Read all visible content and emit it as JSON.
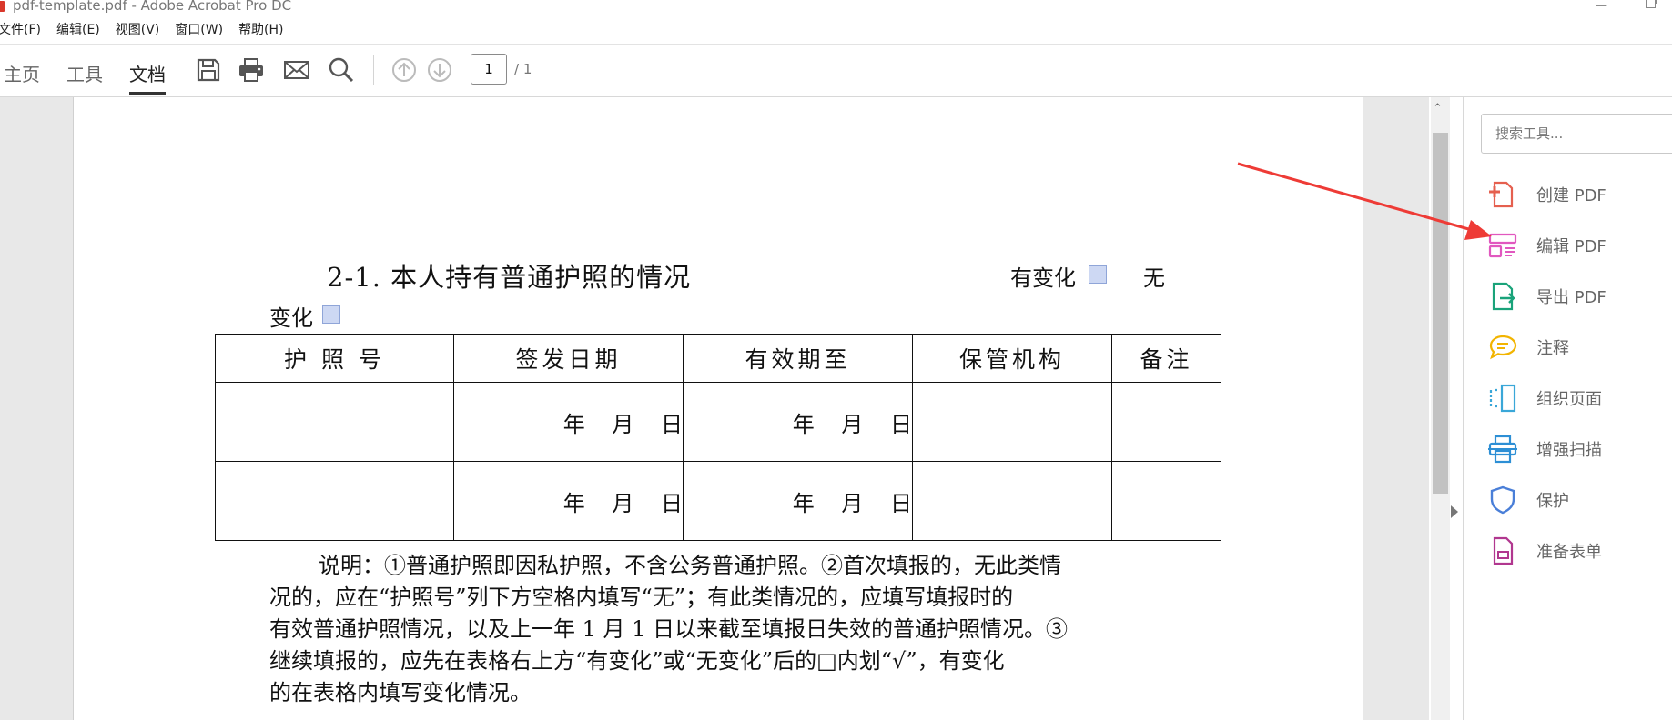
{
  "window": {
    "title": "pdf-template.pdf - Adobe Acrobat Pro DC",
    "minimize": "—"
  },
  "menu": [
    "文件(F)",
    "编辑(E)",
    "视图(V)",
    "窗口(W)",
    "帮助(H)"
  ],
  "nav_tabs": [
    "主页",
    "工具",
    "文档"
  ],
  "active_tab": "文档",
  "toolbar_icons": [
    "save-icon",
    "print-icon",
    "email-icon",
    "search-icon",
    "previous-page-icon",
    "next-page-icon"
  ],
  "page_nav": {
    "current": "1",
    "total": "/ 1"
  },
  "document": {
    "heading": "2-1. 本人持有普通护照的情况",
    "changed_label": "有变化",
    "unchanged_label_1": "无",
    "unchanged_label_2": "变化",
    "table": {
      "headers": [
        "护 照 号",
        "签发日期",
        "有效期至",
        "保管机构",
        "备注"
      ],
      "rows": [
        [
          "",
          "年  月  日",
          "年  月  日",
          "",
          ""
        ],
        [
          "",
          "年  月  日",
          "年  月  日",
          "",
          ""
        ]
      ]
    },
    "note_lines": [
      "说明：①普通护照即因私护照，不含公务普通护照。②首次填报的，无此类情",
      "况的，应在“护照号”列下方空格内填写“无”；有此类情况的，应填写填报时的",
      "有效普通护照情况，以及上一年 1 月 1 日以来截至填报日失效的普通护照情况。③",
      "继续填报的，应先在表格右上方“有变化”或“无变化”后的□内划“√”，有变化",
      "的在表格内填写变化情况。"
    ]
  },
  "right_panel": {
    "search_placeholder": "搜索工具...",
    "tools": [
      {
        "label": "创建 PDF",
        "icon": "create-pdf-icon",
        "color": "#e5604f"
      },
      {
        "label": "编辑 PDF",
        "icon": "edit-pdf-icon",
        "color": "#e158bf"
      },
      {
        "label": "导出 PDF",
        "icon": "export-pdf-icon",
        "color": "#1aa37a"
      },
      {
        "label": "注释",
        "icon": "comment-icon",
        "color": "#f2b400"
      },
      {
        "label": "组织页面",
        "icon": "organize-pages-icon",
        "color": "#3aa7d8"
      },
      {
        "label": "增强扫描",
        "icon": "enhance-scan-icon",
        "color": "#2d8fd5"
      },
      {
        "label": "保护",
        "icon": "protect-icon",
        "color": "#4a7fd8"
      },
      {
        "label": "准备表单",
        "icon": "prepare-form-icon",
        "color": "#b1378f"
      }
    ]
  },
  "annotation": {
    "arrow_color": "#ee3b36"
  }
}
